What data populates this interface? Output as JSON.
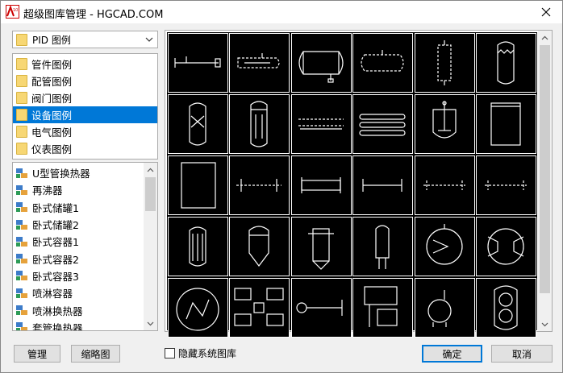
{
  "window": {
    "title": "超级图库管理 - HGCAD.COM",
    "app_icon_text": "A10"
  },
  "library_select": {
    "value": "PID 图例"
  },
  "categories": [
    {
      "label": "管件图例",
      "selected": false
    },
    {
      "label": "配管图例",
      "selected": false
    },
    {
      "label": "阀门图例",
      "selected": false
    },
    {
      "label": "设备图例",
      "selected": true
    },
    {
      "label": "电气图例",
      "selected": false
    },
    {
      "label": "仪表图例",
      "selected": false
    }
  ],
  "items": [
    "U型管换热器",
    "再沸器",
    "卧式储罐1",
    "卧式储罐2",
    "卧式容器1",
    "卧式容器2",
    "卧式容器3",
    "喷淋容器",
    "喷淋换热器",
    "套管换热器"
  ],
  "buttons": {
    "manage": "管理",
    "thumbnail": "缩略图",
    "ok": "确定",
    "cancel": "取消"
  },
  "hide_system_library": {
    "label": "隐藏系统图库",
    "checked": false
  },
  "colors": {
    "accent": "#0078d7",
    "preview_bg": "#000000",
    "symbol": "#ffffff"
  }
}
